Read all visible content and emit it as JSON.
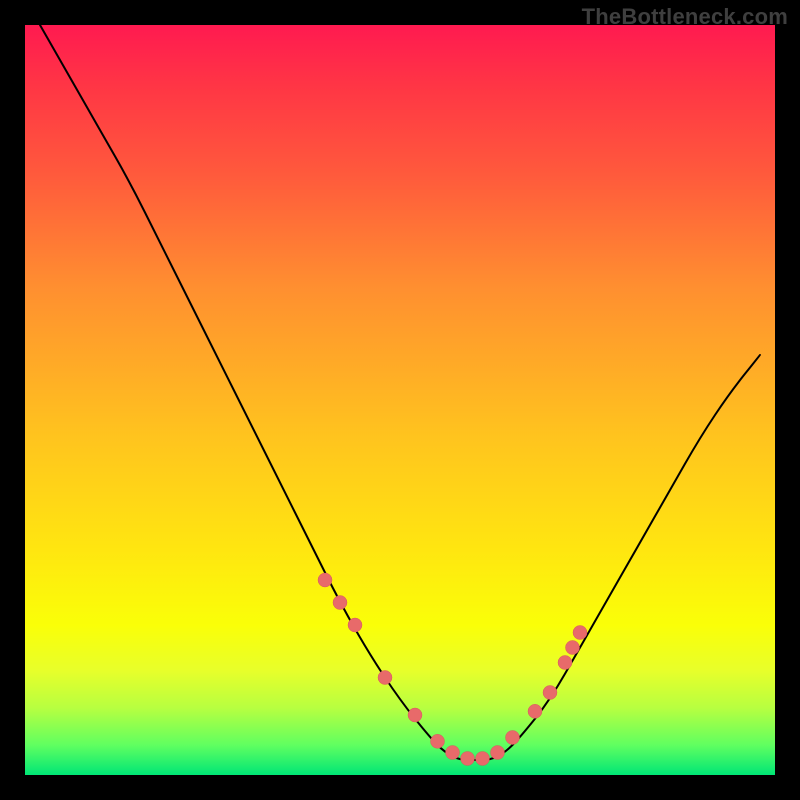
{
  "watermark": {
    "text": "TheBottleneck.com"
  },
  "colors": {
    "bead": "#e86a6a",
    "curve": "#000000",
    "frame_bg_top": "#ff1a50",
    "frame_bg_bottom": "#00e676",
    "page_bg": "#000000"
  },
  "chart_data": {
    "type": "line",
    "title": "",
    "xlabel": "",
    "ylabel": "",
    "xlim": [
      0,
      100
    ],
    "ylim": [
      0,
      100
    ],
    "note": "single unlabeled curve shaped like an asymmetric V; y read as percent height from bottom; flat green band at bottom marks optimal zone",
    "series": [
      {
        "name": "curve",
        "x": [
          2,
          6,
          10,
          14,
          18,
          22,
          26,
          30,
          34,
          38,
          42,
          46,
          50,
          54,
          56,
          58,
          60,
          62,
          64,
          66,
          70,
          74,
          78,
          82,
          86,
          90,
          94,
          98
        ],
        "y": [
          100,
          93,
          86,
          79,
          71,
          63,
          55,
          47,
          39,
          31,
          23,
          16,
          10,
          5,
          3,
          2,
          2,
          2,
          3,
          5,
          10,
          17,
          24,
          31,
          38,
          45,
          51,
          56
        ]
      }
    ],
    "highlight_points": {
      "name": "beads",
      "note": "short run of marker dots near the valley on both arms",
      "x": [
        40,
        42,
        44,
        48,
        52,
        55,
        57,
        59,
        61,
        63,
        65,
        68,
        70,
        72,
        73,
        74
      ],
      "y": [
        26,
        23,
        20,
        13,
        8,
        4.5,
        3,
        2.2,
        2.2,
        3,
        5,
        8.5,
        11,
        15,
        17,
        19
      ]
    }
  }
}
